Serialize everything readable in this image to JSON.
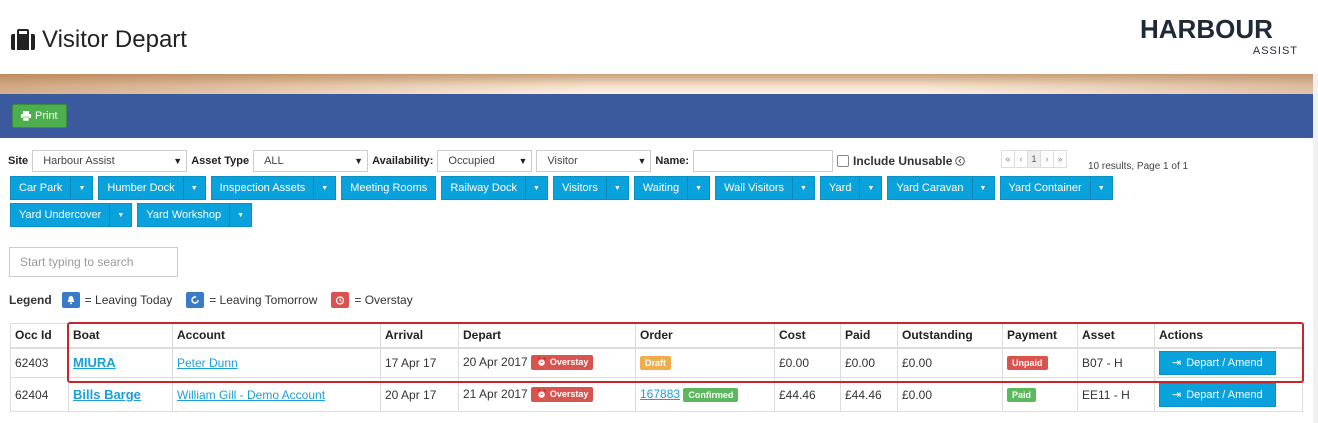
{
  "header": {
    "title": "Visitor Depart",
    "logo_main": "HARBOUR",
    "logo_sub": "ASSIST"
  },
  "toolbar": {
    "print_label": "Print"
  },
  "filters": {
    "site_label": "Site",
    "site_value": "Harbour Assist",
    "asset_type_label": "Asset Type",
    "asset_type_value": "ALL",
    "availability_label": "Availability:",
    "availability_value": "Occupied",
    "visitor_value": "Visitor",
    "name_label": "Name:",
    "name_value": "",
    "include_unusable_label": "Include Unusable",
    "pager": [
      "«",
      "‹",
      "1",
      "›",
      "»"
    ],
    "results_text": "10 results, Page 1 of 1"
  },
  "asset_buttons": [
    {
      "label": "Car Park",
      "dropdown": true
    },
    {
      "label": "Humber Dock",
      "dropdown": true
    },
    {
      "label": "Inspection Assets",
      "dropdown": true
    },
    {
      "label": "Meeting Rooms",
      "dropdown": false
    },
    {
      "label": "Railway Dock",
      "dropdown": true
    },
    {
      "label": "Visitors",
      "dropdown": true
    },
    {
      "label": "Waiting",
      "dropdown": true
    },
    {
      "label": "Wall Visitors",
      "dropdown": true
    },
    {
      "label": "Yard",
      "dropdown": true
    },
    {
      "label": "Yard Caravan",
      "dropdown": true
    },
    {
      "label": "Yard Container",
      "dropdown": true
    },
    {
      "label": "Yard Undercover",
      "dropdown": true
    },
    {
      "label": "Yard Workshop",
      "dropdown": true
    }
  ],
  "search": {
    "placeholder": "Start typing to search"
  },
  "legend": {
    "title": "Legend",
    "items": [
      {
        "text": "= Leaving Today",
        "color": "#3a7bc8",
        "icon": "bell-icon"
      },
      {
        "text": "= Leaving Tomorrow",
        "color": "#3a7bc8",
        "icon": "refresh-icon"
      },
      {
        "text": "= Overstay",
        "color": "#d9534f",
        "icon": "alarm-clock-icon"
      }
    ]
  },
  "table": {
    "columns": [
      "Occ Id",
      "Boat",
      "Account",
      "Arrival",
      "Depart",
      "Order",
      "Cost",
      "Paid",
      "Outstanding",
      "Payment",
      "Asset",
      "Actions"
    ],
    "rows": [
      {
        "occ_id": "62403",
        "boat": "MIURA",
        "account": "Peter Dunn",
        "arrival": "17 Apr 17",
        "depart": "20 Apr 2017",
        "depart_badge": "Overstay",
        "order_link": "",
        "order_badge": "Draft",
        "cost": "£0.00",
        "paid": "£0.00",
        "outstanding": "£0.00",
        "payment": "Unpaid",
        "asset": "B07 - H",
        "action": "Depart / Amend"
      },
      {
        "occ_id": "62404",
        "boat": "Bills Barge",
        "account": "William Gill - Demo Account",
        "arrival": "20 Apr 17",
        "depart": "21 Apr 2017",
        "depart_badge": "Overstay",
        "order_link": "167883",
        "order_badge": "Confirmed",
        "cost": "£44.46",
        "paid": "£44.46",
        "outstanding": "£0.00",
        "payment": "Paid",
        "asset": "EE11 - H",
        "action": "Depart / Amend"
      }
    ]
  }
}
